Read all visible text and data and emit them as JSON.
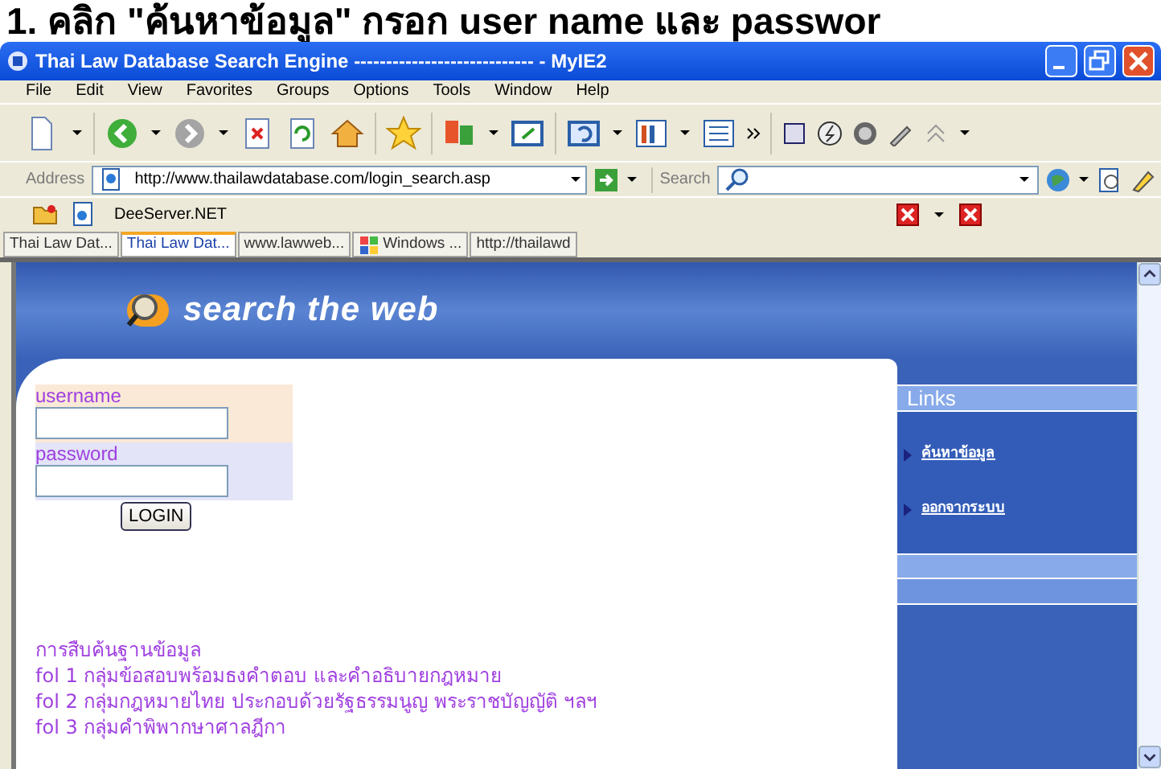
{
  "instruction_heading": "1. คลิก \"ค้นหาข้อมูล\" กรอก user name และ passwor",
  "window": {
    "title": "Thai Law Database Search Engine ---------------------------- - MyIE2"
  },
  "menu": [
    "File",
    "Edit",
    "View",
    "Favorites",
    "Groups",
    "Options",
    "Tools",
    "Window",
    "Help"
  ],
  "address_bar": {
    "label": "Address",
    "value": "http://www.thailawdatabase.com/login_search.asp"
  },
  "search_bar": {
    "label": "Search"
  },
  "links_bar": {
    "items": [
      "DeeServer.NET"
    ]
  },
  "tabs": [
    {
      "label": "Thai Law Dat...",
      "selected": false
    },
    {
      "label": "Thai Law Dat...",
      "selected": true
    },
    {
      "label": "www.lawweb...",
      "selected": false
    },
    {
      "label": "Windows ...",
      "selected": false
    },
    {
      "label": "http://thailawd",
      "selected": false
    }
  ],
  "page": {
    "banner": "search the web",
    "login": {
      "username_label": "username",
      "password_label": "password",
      "button": "LOGIN"
    },
    "links_title": "Links",
    "links": [
      "ค้นหาข้อมูล",
      "ออกจากระบบ"
    ],
    "description": [
      "การสืบค้นฐานข้อมูล",
      "fol 1 กลุ่มข้อสอบพร้อมธงคำตอบ และคำอธิบายกฎหมาย",
      "fol 2 กลุ่มกฎหมายไทย ประกอบด้วยรัฐธรรมนูญ พระราชบัญญัติ ฯลฯ",
      "fol 3 กลุ่มคำพิพากษาศาลฎีกา"
    ]
  }
}
